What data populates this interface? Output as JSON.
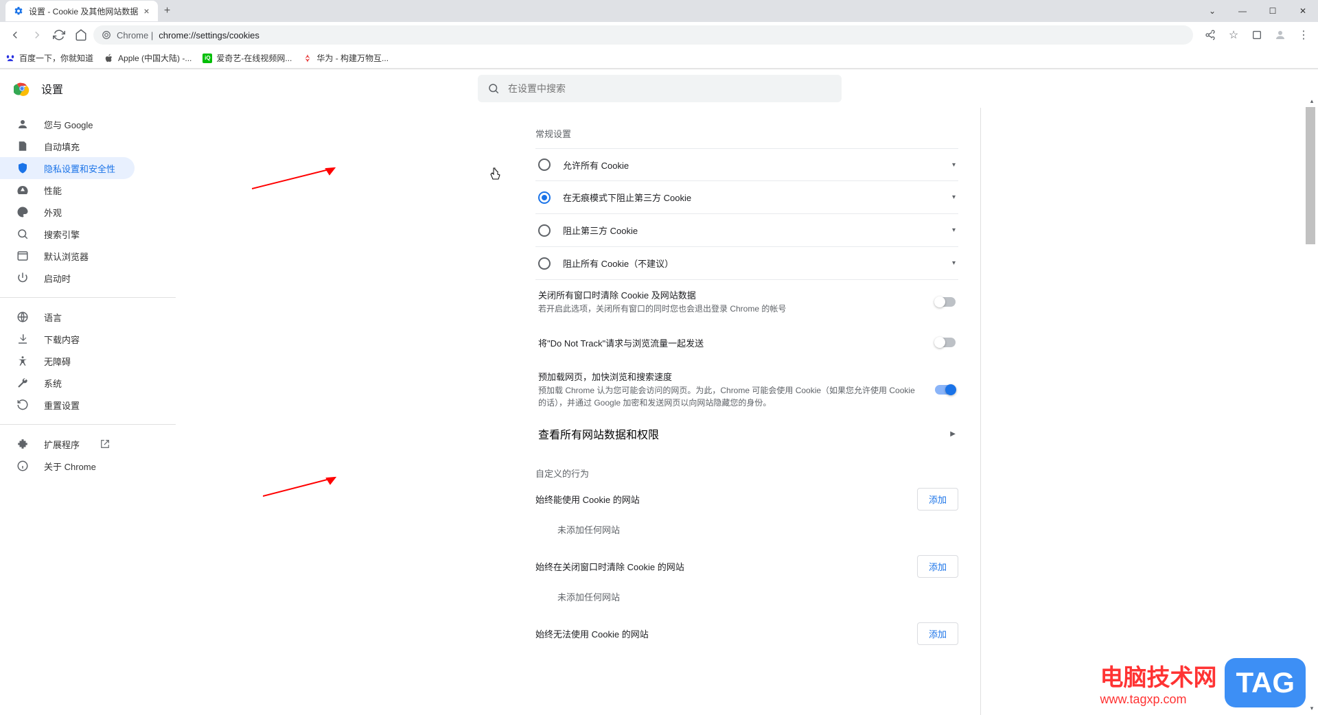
{
  "window": {
    "tab_title": "设置 - Cookie 及其他网站数据",
    "url_prefix": "Chrome |",
    "url_path": "chrome://settings/cookies"
  },
  "bookmarks": [
    {
      "label": "百度一下，你就知道",
      "favicon_color": "#2932e1"
    },
    {
      "label": "Apple (中国大陆) -...",
      "favicon_color": "#555"
    },
    {
      "label": "爱奇艺-在线视频网...",
      "favicon_color": "#00be06"
    },
    {
      "label": "华为 - 构建万物互...",
      "favicon_color": "#e63030"
    }
  ],
  "settings_title": "设置",
  "search_placeholder": "在设置中搜索",
  "sidebar": [
    {
      "icon": "person",
      "label": "您与 Google"
    },
    {
      "icon": "assignment",
      "label": "自动填充"
    },
    {
      "icon": "shield",
      "label": "隐私设置和安全性",
      "active": true
    },
    {
      "icon": "speed",
      "label": "性能"
    },
    {
      "icon": "palette",
      "label": "外观"
    },
    {
      "icon": "search",
      "label": "搜索引擎"
    },
    {
      "icon": "browser",
      "label": "默认浏览器"
    },
    {
      "icon": "power",
      "label": "启动时"
    },
    {
      "divider": true
    },
    {
      "icon": "language",
      "label": "语言"
    },
    {
      "icon": "download",
      "label": "下载内容"
    },
    {
      "icon": "accessibility",
      "label": "无障碍"
    },
    {
      "icon": "wrench",
      "label": "系统"
    },
    {
      "icon": "restore",
      "label": "重置设置"
    },
    {
      "divider": true
    },
    {
      "icon": "extension",
      "label": "扩展程序",
      "ext_link": true
    },
    {
      "icon": "info",
      "label": "关于 Chrome"
    }
  ],
  "section_general": "常规设置",
  "radios": [
    {
      "label": "允许所有 Cookie",
      "selected": false
    },
    {
      "label": "在无痕模式下阻止第三方 Cookie",
      "selected": true
    },
    {
      "label": "阻止第三方 Cookie",
      "selected": false
    },
    {
      "label": "阻止所有 Cookie（不建议）",
      "selected": false
    }
  ],
  "toggles": [
    {
      "title": "关闭所有窗口时清除 Cookie 及网站数据",
      "sub": "若开启此选项，关闭所有窗口的同时您也会退出登录 Chrome 的帐号",
      "on": false
    },
    {
      "title": "将\"Do Not Track\"请求与浏览流量一起发送",
      "sub": "",
      "on": false
    },
    {
      "title": "预加载网页，加快浏览和搜索速度",
      "sub": "预加载 Chrome 认为您可能会访问的网页。为此，Chrome 可能会使用 Cookie（如果您允许使用 Cookie 的话），并通过 Google 加密和发送网页以向网站隐藏您的身份。",
      "on": true
    }
  ],
  "link_row_label": "查看所有网站数据和权限",
  "section_custom": "自定义的行为",
  "custom_blocks": [
    {
      "label": "始终能使用 Cookie 的网站",
      "add": "添加",
      "empty": "未添加任何网站"
    },
    {
      "label": "始终在关闭窗口时清除 Cookie 的网站",
      "add": "添加",
      "empty": "未添加任何网站"
    },
    {
      "label": "始终无法使用 Cookie 的网站",
      "add": "添加",
      "empty": ""
    }
  ],
  "watermark": {
    "line1": "电脑技术网",
    "line2": "www.tagxp.com",
    "badge": "TAG"
  }
}
